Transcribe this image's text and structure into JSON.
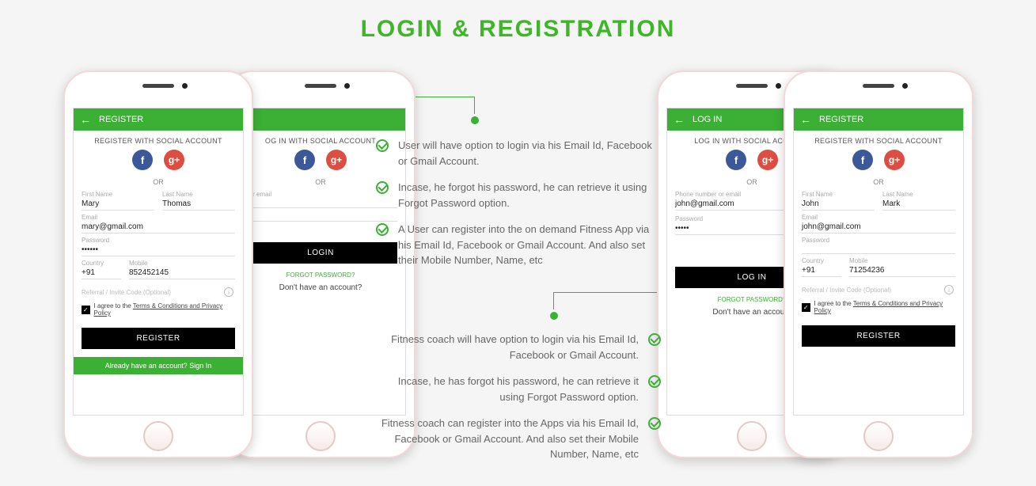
{
  "page_title": "LOGIN & REGISTRATION",
  "colors": {
    "accent": "#3cb035"
  },
  "phones": {
    "register_left": {
      "topbar": "REGISTER",
      "social_header": "REGISTER WITH SOCIAL ACCOUNT",
      "or": "OR",
      "first_name_label": "First Name",
      "first_name": "Mary",
      "last_name_label": "Last Name",
      "last_name": "Thomas",
      "email_label": "Email",
      "email": "mary@gmail.com",
      "password_label": "Password",
      "password": "••••••",
      "country_label": "Country",
      "country": "+91",
      "mobile_label": "Mobile",
      "mobile": "852452145",
      "referral": "Referral / Invite Code (Optional)",
      "agree_prefix": "I agree to the ",
      "agree_link": "Terms & Conditions and Privacy Policy",
      "register_btn": "REGISTER",
      "footer": "Already have an account? Sign In"
    },
    "login_left": {
      "social_header": "OG IN WITH SOCIAL ACCOUNT",
      "or": "OR",
      "field_label": "e or email",
      "login_btn": "LOGIN",
      "forgot": "FORGOT PASSWORD?",
      "no_account": "Don't have an account?"
    },
    "login_right": {
      "topbar": "LOG IN",
      "social_header": "LOG IN WITH SOCIAL ACCOUNT",
      "or": "OR",
      "phone_label": "Phone number or email",
      "phone_value": "john@gmail.com",
      "password_label": "Password",
      "password": "•••••",
      "login_btn": "LOG IN",
      "forgot": "FORGOT PASSWORD?",
      "no_account": "Don't have an account"
    },
    "register_right": {
      "topbar": "REGISTER",
      "social_header": "REGISTER WITH SOCIAL ACCOUNT",
      "or": "OR",
      "first_name_label": "First Name",
      "first_name": "John",
      "last_name_label": "Last Name",
      "last_name": "Mark",
      "email_label": "Email",
      "email": "john@gmail.com",
      "password_label": "Password",
      "password": "",
      "country_label": "Country",
      "country": "+91",
      "mobile_label": "Mobile",
      "mobile": "71254236",
      "referral": "Referral / Invite Code (Optional)",
      "agree_prefix": "I agree to the ",
      "agree_link": "Terms & Conditions and Privacy Policy",
      "register_btn": "REGISTER"
    }
  },
  "features_user": [
    "User will have option to login via his Email Id, Facebook or Gmail Account.",
    "Incase, he forgot his password, he can retrieve it using Forgot Password option.",
    "A User can register into the on demand Fitness App via his Email Id, Facebook or Gmail Account. And also set their Mobile Number, Name, etc"
  ],
  "features_coach": [
    "Fitness coach will have option to login via his Email Id, Facebook or Gmail Account.",
    "Incase, he has forgot his password, he can retrieve it using Forgot Password option.",
    "Fitness coach can register into the Apps via his Email Id, Facebook or Gmail Account. And also set their Mobile Number, Name, etc"
  ]
}
